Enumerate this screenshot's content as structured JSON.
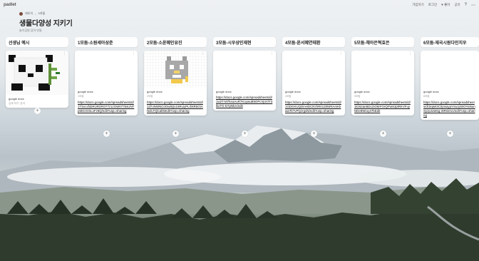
{
  "app": {
    "brand": "padlet"
  },
  "topbar": {
    "actions": [
      {
        "label": "가입하기",
        "name": "signup-link"
      },
      {
        "label": "로그인",
        "name": "login-link"
      },
      {
        "label": "♥ 좋아",
        "name": "like-button"
      },
      {
        "label": "공유",
        "name": "share-button"
      }
    ],
    "help_icon": "?",
    "more_icon": "⋯"
  },
  "header": {
    "author": "재호의",
    "date": "5개월",
    "title": "생물다양성 지키기",
    "subtitle": "놀이공원 답아 만들"
  },
  "columns": [
    {
      "title": "선생님 예시",
      "card": {
        "thumb": "panda",
        "source": "google docs",
        "author": "김재 작가 ·분석",
        "link": ""
      }
    },
    {
      "title": "1모둠-소원세아상춘",
      "card": {
        "thumb": "blank",
        "source": "google docs",
        "author": "1모둠",
        "link": "https://docs.google.com/spreadsheets/d/1TSvcxfxbRUR2RO77z1zGW0776sUNTpMGzGSLoFz8Q/edit?usp=sharing"
      }
    },
    {
      "title": "2모둠-소윤혜인유진",
      "card": {
        "thumb": "cat",
        "source": "google docs",
        "author": "2모둠",
        "link": "https://docs.google.com/spreadsheets/d/1d7oNWNOJOw8Qv15RuiyPLrbkR6GtANxlLTQlcal/Medit?usp=sharing"
      }
    },
    {
      "title": "3모둠-시우상민재현",
      "card": {
        "thumb": "blank",
        "source": "google docs",
        "author": "",
        "link": "https://docs.google.com/spreadsheets/d/1w2T-M7heaAuR7KoywuB9OPoYpX7F3lkxTO-D7pNbA/edit"
      }
    },
    {
      "title": "4모둠-윤서혜연태환",
      "card": {
        "thumb": "blank",
        "source": "google docs",
        "author": "4모둠",
        "link": "https://docs.google.com/spreadsheets/d/1GDGKUQDmHDCRzhR0130NRtAmKkaiaTkTvPQzrgvl5/edit?usp=sharing"
      }
    },
    {
      "title": "5모둠-채아은혁효은",
      "card": {
        "thumb": "blank",
        "source": "google docs",
        "author": "5모둠",
        "link": "https://docs.google.com/spreadsheets/d/1kz62aeBDc2IO8rFOrQPoMJptRKVFuyNDe8Wruy47bEdit"
      }
    },
    {
      "title": "6모둠-재국시원다민지우",
      "card": {
        "thumb": "blank",
        "source": "google docs",
        "author": "6모둠",
        "link": "https://docs.google.com/spreadsheets/d/1kqW3C0j4saypYSuzpWOYaNunSyzpJuWeg.WRnkrs1/edit?usp=sharing"
      }
    }
  ]
}
